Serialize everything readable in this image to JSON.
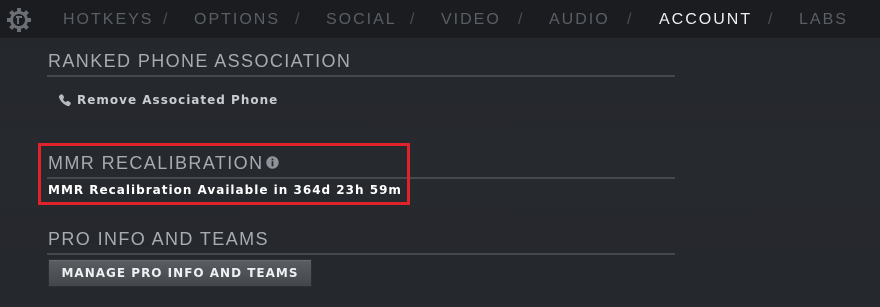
{
  "nav": {
    "tabs": [
      {
        "label": "HOTKEYS",
        "active": false
      },
      {
        "label": "OPTIONS",
        "active": false
      },
      {
        "label": "SOCIAL",
        "active": false
      },
      {
        "label": "VIDEO",
        "active": false
      },
      {
        "label": "AUDIO",
        "active": false
      },
      {
        "label": "ACCOUNT",
        "active": true
      },
      {
        "label": "LABS",
        "active": false
      }
    ],
    "separator": "/"
  },
  "ranked_phone": {
    "title": "RANKED PHONE ASSOCIATION",
    "remove_link": "Remove Associated Phone",
    "icon": "phone-icon"
  },
  "mmr": {
    "title": "MMR RECALIBRATION",
    "icon": "info-icon",
    "status": "MMR Recalibration Available in 364d 23h 59m"
  },
  "pro": {
    "title": "PRO INFO AND TEAMS",
    "button_label": "MANAGE PRO INFO AND TEAMS"
  },
  "colors": {
    "background": "#26292e",
    "nav_background": "#1a1c1f",
    "highlight_border": "#e0232a",
    "active_tab": "#eef0f2",
    "inactive_tab": "#5a5f66"
  }
}
